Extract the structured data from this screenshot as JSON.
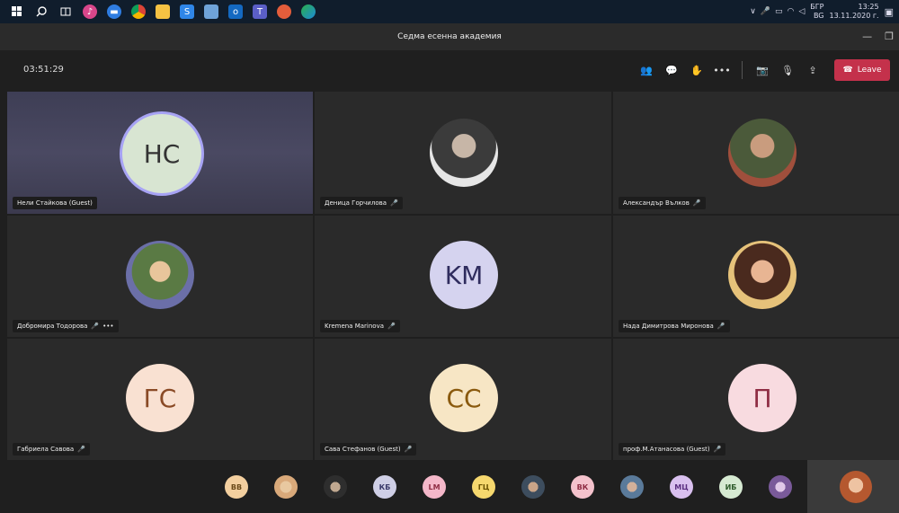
{
  "taskbar": {
    "icons": [
      "windows-icon",
      "search-icon",
      "task-view-icon",
      "itunes-icon",
      "chat-icon",
      "chrome-icon",
      "file-explorer-icon",
      "skype-icon",
      "tablet-icon",
      "outlook-icon",
      "teams-icon",
      "app-icon",
      "edge-icon"
    ],
    "tray_lang_top": "БГР",
    "tray_lang_bottom": "BG",
    "time": "13:25",
    "date": "13.11.2020 г."
  },
  "window": {
    "title": "Седма есенна академия"
  },
  "callbar": {
    "timer": "03:51:29",
    "leave_label": "Leave"
  },
  "participants": [
    {
      "name": "Нели Стайкова (Guest)",
      "initials": "НС",
      "type": "initials",
      "bg": "#d8e5d2",
      "fg": "#333333",
      "active": true,
      "muted": false
    },
    {
      "name": "Деница Горчилова",
      "type": "photo",
      "muted": true
    },
    {
      "name": "Александър Вълков",
      "type": "photo",
      "muted": true
    },
    {
      "name": "Добромира Тодорова",
      "type": "photo",
      "muted": true,
      "more": "•••"
    },
    {
      "name": "Kremena Marinova",
      "initials": "KM",
      "type": "initials",
      "bg": "#d5d3ef",
      "fg": "#2f2c5e",
      "muted": true
    },
    {
      "name": "Нада Димитрова Миронова",
      "type": "photo",
      "muted": true
    },
    {
      "name": "Габриела Савова",
      "initials": "ГС",
      "type": "initials",
      "bg": "#f9e1d2",
      "fg": "#8a4a26",
      "muted": true
    },
    {
      "name": "Сава Стефанов (Guest)",
      "initials": "СС",
      "type": "initials",
      "bg": "#f7e6c5",
      "fg": "#8a5a0e",
      "muted": true
    },
    {
      "name": "проф.М.Атанасова (Guest)",
      "initials": "П",
      "type": "initials",
      "bg": "#f8dbe0",
      "fg": "#8f2d44",
      "muted": true
    }
  ],
  "overflow": [
    {
      "initials": "BB",
      "bg": "#f3cf9f",
      "fg": "#6a4a1a"
    },
    {
      "initials": "",
      "photo": true,
      "bg": "#d9a97a"
    },
    {
      "initials": "",
      "photo": true,
      "bg": "#6b6b6b"
    },
    {
      "initials": "КБ",
      "bg": "#cfcfe6",
      "fg": "#3a3a6a"
    },
    {
      "initials": "LM",
      "bg": "#f4b7c9",
      "fg": "#8f2d44"
    },
    {
      "initials": "ГЦ",
      "bg": "#f6d86e",
      "fg": "#6a5200"
    },
    {
      "initials": "",
      "photo": true,
      "bg": "#8a7a6a"
    },
    {
      "initials": "ВК",
      "bg": "#f4c2cc",
      "fg": "#8f2d44"
    },
    {
      "initials": "",
      "photo": true,
      "bg": "#7a8a9a"
    },
    {
      "initials": "МЦ",
      "bg": "#d9c0ef",
      "fg": "#5a2e80"
    },
    {
      "initials": "ИБ",
      "bg": "#d6ead2",
      "fg": "#2d5a2a"
    },
    {
      "initials": "",
      "photo": true,
      "bg": "#b9b0c9"
    }
  ]
}
